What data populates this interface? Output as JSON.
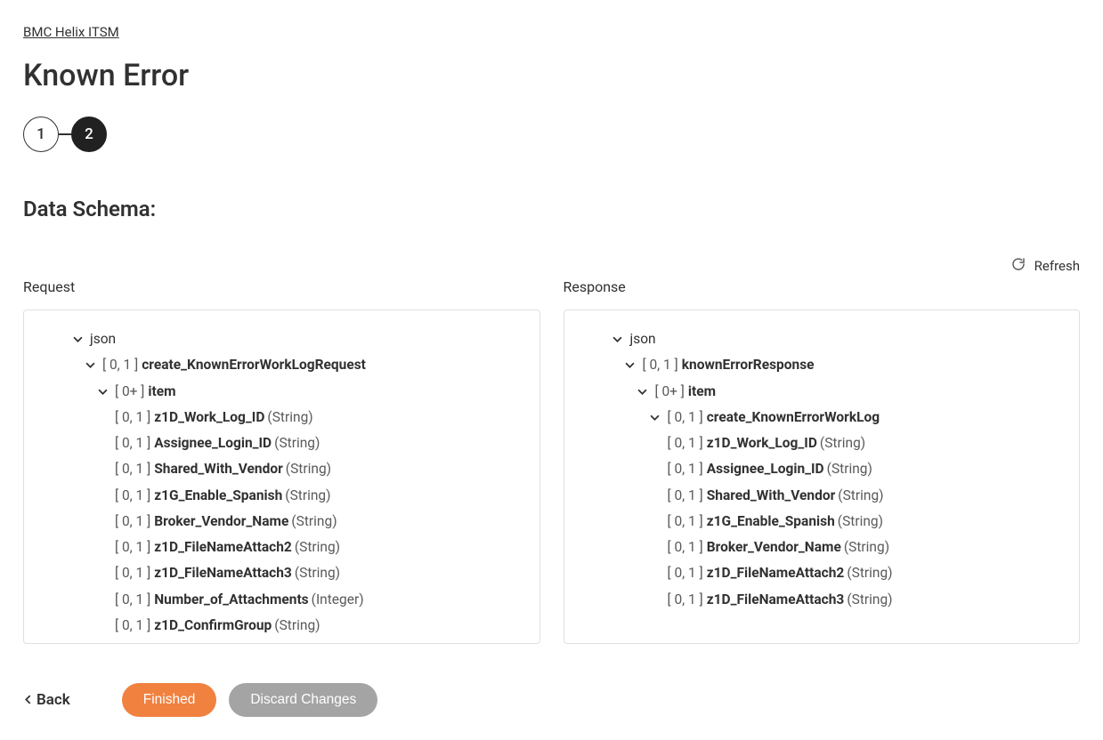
{
  "breadcrumb": {
    "label": "BMC Helix ITSM"
  },
  "page_title": "Known Error",
  "stepper": {
    "step1": "1",
    "step2": "2"
  },
  "section_heading": "Data Schema:",
  "refresh": {
    "label": "Refresh"
  },
  "request": {
    "header": "Request",
    "root_label": "json",
    "root_card": "[ 0, 1 ]",
    "root_name": "create_KnownErrorWorkLogRequest",
    "item_card": "[ 0+ ]",
    "item_name": "item",
    "fields": [
      {
        "card": "[ 0, 1 ]",
        "name": "z1D_Work_Log_ID",
        "type": "(String)"
      },
      {
        "card": "[ 0, 1 ]",
        "name": "Assignee_Login_ID",
        "type": "(String)"
      },
      {
        "card": "[ 0, 1 ]",
        "name": "Shared_With_Vendor",
        "type": "(String)"
      },
      {
        "card": "[ 0, 1 ]",
        "name": "z1G_Enable_Spanish",
        "type": "(String)"
      },
      {
        "card": "[ 0, 1 ]",
        "name": "Broker_Vendor_Name",
        "type": "(String)"
      },
      {
        "card": "[ 0, 1 ]",
        "name": "z1D_FileNameAttach2",
        "type": "(String)"
      },
      {
        "card": "[ 0, 1 ]",
        "name": "z1D_FileNameAttach3",
        "type": "(String)"
      },
      {
        "card": "[ 0, 1 ]",
        "name": "Number_of_Attachments",
        "type": "(Integer)"
      },
      {
        "card": "[ 0, 1 ]",
        "name": "z1D_ConfirmGroup",
        "type": "(String)"
      }
    ]
  },
  "response": {
    "header": "Response",
    "root_label": "json",
    "root_card": "[ 0, 1 ]",
    "root_name": "knownErrorResponse",
    "item_card": "[ 0+ ]",
    "item_name": "item",
    "inner_card": "[ 0, 1 ]",
    "inner_name": "create_KnownErrorWorkLog",
    "fields": [
      {
        "card": "[ 0, 1 ]",
        "name": "z1D_Work_Log_ID",
        "type": "(String)"
      },
      {
        "card": "[ 0, 1 ]",
        "name": "Assignee_Login_ID",
        "type": "(String)"
      },
      {
        "card": "[ 0, 1 ]",
        "name": "Shared_With_Vendor",
        "type": "(String)"
      },
      {
        "card": "[ 0, 1 ]",
        "name": "z1G_Enable_Spanish",
        "type": "(String)"
      },
      {
        "card": "[ 0, 1 ]",
        "name": "Broker_Vendor_Name",
        "type": "(String)"
      },
      {
        "card": "[ 0, 1 ]",
        "name": "z1D_FileNameAttach2",
        "type": "(String)"
      },
      {
        "card": "[ 0, 1 ]",
        "name": "z1D_FileNameAttach3",
        "type": "(String)"
      }
    ]
  },
  "footer": {
    "back": "Back",
    "finished": "Finished",
    "discard": "Discard Changes"
  }
}
